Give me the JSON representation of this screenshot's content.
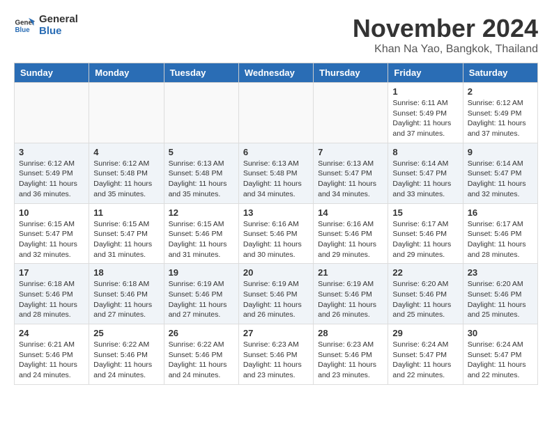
{
  "header": {
    "logo_general": "General",
    "logo_blue": "Blue",
    "month_title": "November 2024",
    "location": "Khan Na Yao, Bangkok, Thailand"
  },
  "calendar": {
    "headers": [
      "Sunday",
      "Monday",
      "Tuesday",
      "Wednesday",
      "Thursday",
      "Friday",
      "Saturday"
    ],
    "weeks": [
      [
        {
          "day": "",
          "info": ""
        },
        {
          "day": "",
          "info": ""
        },
        {
          "day": "",
          "info": ""
        },
        {
          "day": "",
          "info": ""
        },
        {
          "day": "",
          "info": ""
        },
        {
          "day": "1",
          "info": "Sunrise: 6:11 AM\nSunset: 5:49 PM\nDaylight: 11 hours and 37 minutes."
        },
        {
          "day": "2",
          "info": "Sunrise: 6:12 AM\nSunset: 5:49 PM\nDaylight: 11 hours and 37 minutes."
        }
      ],
      [
        {
          "day": "3",
          "info": "Sunrise: 6:12 AM\nSunset: 5:49 PM\nDaylight: 11 hours and 36 minutes."
        },
        {
          "day": "4",
          "info": "Sunrise: 6:12 AM\nSunset: 5:48 PM\nDaylight: 11 hours and 35 minutes."
        },
        {
          "day": "5",
          "info": "Sunrise: 6:13 AM\nSunset: 5:48 PM\nDaylight: 11 hours and 35 minutes."
        },
        {
          "day": "6",
          "info": "Sunrise: 6:13 AM\nSunset: 5:48 PM\nDaylight: 11 hours and 34 minutes."
        },
        {
          "day": "7",
          "info": "Sunrise: 6:13 AM\nSunset: 5:47 PM\nDaylight: 11 hours and 34 minutes."
        },
        {
          "day": "8",
          "info": "Sunrise: 6:14 AM\nSunset: 5:47 PM\nDaylight: 11 hours and 33 minutes."
        },
        {
          "day": "9",
          "info": "Sunrise: 6:14 AM\nSunset: 5:47 PM\nDaylight: 11 hours and 32 minutes."
        }
      ],
      [
        {
          "day": "10",
          "info": "Sunrise: 6:15 AM\nSunset: 5:47 PM\nDaylight: 11 hours and 32 minutes."
        },
        {
          "day": "11",
          "info": "Sunrise: 6:15 AM\nSunset: 5:47 PM\nDaylight: 11 hours and 31 minutes."
        },
        {
          "day": "12",
          "info": "Sunrise: 6:15 AM\nSunset: 5:46 PM\nDaylight: 11 hours and 31 minutes."
        },
        {
          "day": "13",
          "info": "Sunrise: 6:16 AM\nSunset: 5:46 PM\nDaylight: 11 hours and 30 minutes."
        },
        {
          "day": "14",
          "info": "Sunrise: 6:16 AM\nSunset: 5:46 PM\nDaylight: 11 hours and 29 minutes."
        },
        {
          "day": "15",
          "info": "Sunrise: 6:17 AM\nSunset: 5:46 PM\nDaylight: 11 hours and 29 minutes."
        },
        {
          "day": "16",
          "info": "Sunrise: 6:17 AM\nSunset: 5:46 PM\nDaylight: 11 hours and 28 minutes."
        }
      ],
      [
        {
          "day": "17",
          "info": "Sunrise: 6:18 AM\nSunset: 5:46 PM\nDaylight: 11 hours and 28 minutes."
        },
        {
          "day": "18",
          "info": "Sunrise: 6:18 AM\nSunset: 5:46 PM\nDaylight: 11 hours and 27 minutes."
        },
        {
          "day": "19",
          "info": "Sunrise: 6:19 AM\nSunset: 5:46 PM\nDaylight: 11 hours and 27 minutes."
        },
        {
          "day": "20",
          "info": "Sunrise: 6:19 AM\nSunset: 5:46 PM\nDaylight: 11 hours and 26 minutes."
        },
        {
          "day": "21",
          "info": "Sunrise: 6:19 AM\nSunset: 5:46 PM\nDaylight: 11 hours and 26 minutes."
        },
        {
          "day": "22",
          "info": "Sunrise: 6:20 AM\nSunset: 5:46 PM\nDaylight: 11 hours and 25 minutes."
        },
        {
          "day": "23",
          "info": "Sunrise: 6:20 AM\nSunset: 5:46 PM\nDaylight: 11 hours and 25 minutes."
        }
      ],
      [
        {
          "day": "24",
          "info": "Sunrise: 6:21 AM\nSunset: 5:46 PM\nDaylight: 11 hours and 24 minutes."
        },
        {
          "day": "25",
          "info": "Sunrise: 6:22 AM\nSunset: 5:46 PM\nDaylight: 11 hours and 24 minutes."
        },
        {
          "day": "26",
          "info": "Sunrise: 6:22 AM\nSunset: 5:46 PM\nDaylight: 11 hours and 24 minutes."
        },
        {
          "day": "27",
          "info": "Sunrise: 6:23 AM\nSunset: 5:46 PM\nDaylight: 11 hours and 23 minutes."
        },
        {
          "day": "28",
          "info": "Sunrise: 6:23 AM\nSunset: 5:46 PM\nDaylight: 11 hours and 23 minutes."
        },
        {
          "day": "29",
          "info": "Sunrise: 6:24 AM\nSunset: 5:47 PM\nDaylight: 11 hours and 22 minutes."
        },
        {
          "day": "30",
          "info": "Sunrise: 6:24 AM\nSunset: 5:47 PM\nDaylight: 11 hours and 22 minutes."
        }
      ]
    ]
  }
}
